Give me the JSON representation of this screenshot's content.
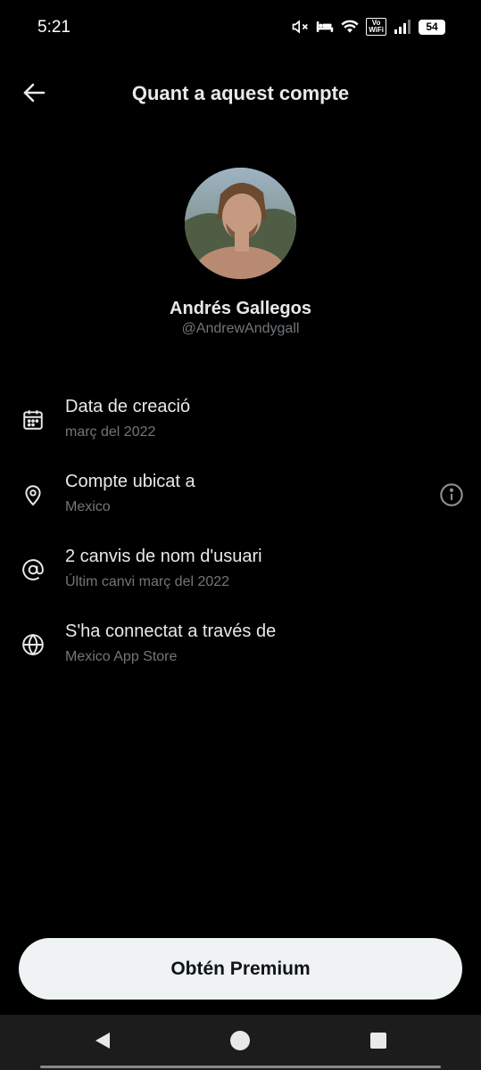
{
  "status_bar": {
    "time": "5:21",
    "volte_top": "Vo",
    "volte_bottom": "WiFi",
    "battery": "54",
    "icons": [
      "vibrate-off-icon",
      "bed-icon",
      "wifi-icon",
      "volte-icon",
      "signal-icon",
      "battery-icon"
    ]
  },
  "header": {
    "title": "Quant a aquest compte",
    "back_icon": "arrow-left-icon"
  },
  "profile": {
    "display_name": "Andrés Gallegos",
    "username": "@AndrewAndygall"
  },
  "info": {
    "items": [
      {
        "icon": "calendar-icon",
        "title": "Data de creació",
        "subtitle": "març del 2022"
      },
      {
        "icon": "location-pin-icon",
        "title": "Compte ubicat a",
        "subtitle": "Mexico",
        "extra_icon": "info-circle-icon"
      },
      {
        "icon": "at-sign-icon",
        "title": "2 canvis de nom d'usuari",
        "subtitle": "Últim canvi març del 2022"
      },
      {
        "icon": "globe-icon",
        "title": "S'ha connectat a través de",
        "subtitle": "Mexico App Store"
      }
    ]
  },
  "cta": {
    "label": "Obtén Premium"
  },
  "nav": {
    "icons": [
      "back-triangle-icon",
      "home-circle-icon",
      "recents-square-icon"
    ]
  },
  "colors": {
    "background": "#000000",
    "primary_text": "#e7e9ea",
    "secondary_text": "#71767b",
    "button_bg": "#eff3f4",
    "button_text": "#0f1419"
  }
}
